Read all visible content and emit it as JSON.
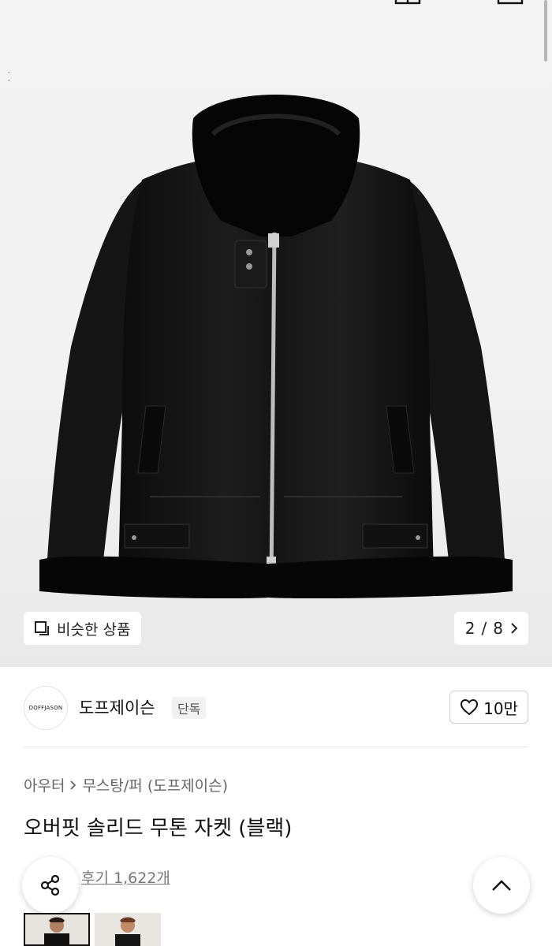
{
  "gallery": {
    "similar_label": "비슷한 상품",
    "current": "2",
    "total": "8",
    "pager_sep": " / "
  },
  "brand": {
    "logo_text": "DOFFJASON",
    "name": "도프제이슨",
    "tag": "단독",
    "likes": "10만"
  },
  "breadcrumb": {
    "category": "아우터",
    "subcategory": "무스탕/퍼 (도프제이슨)"
  },
  "product": {
    "title": "오버핏 솔리드 무톤 자켓 (블랙)",
    "review_label": "후기 1,622개"
  },
  "icons": {
    "share": "share-icon",
    "scroll_top": "chevron-up-icon",
    "similar": "copy-squares-icon",
    "pager_next": "chevron-right-icon",
    "heart": "heart-icon"
  },
  "colors": {
    "background": "#ffffff",
    "image_bg": "#f2f2f2",
    "text_primary": "#111111",
    "text_secondary": "#666666"
  }
}
